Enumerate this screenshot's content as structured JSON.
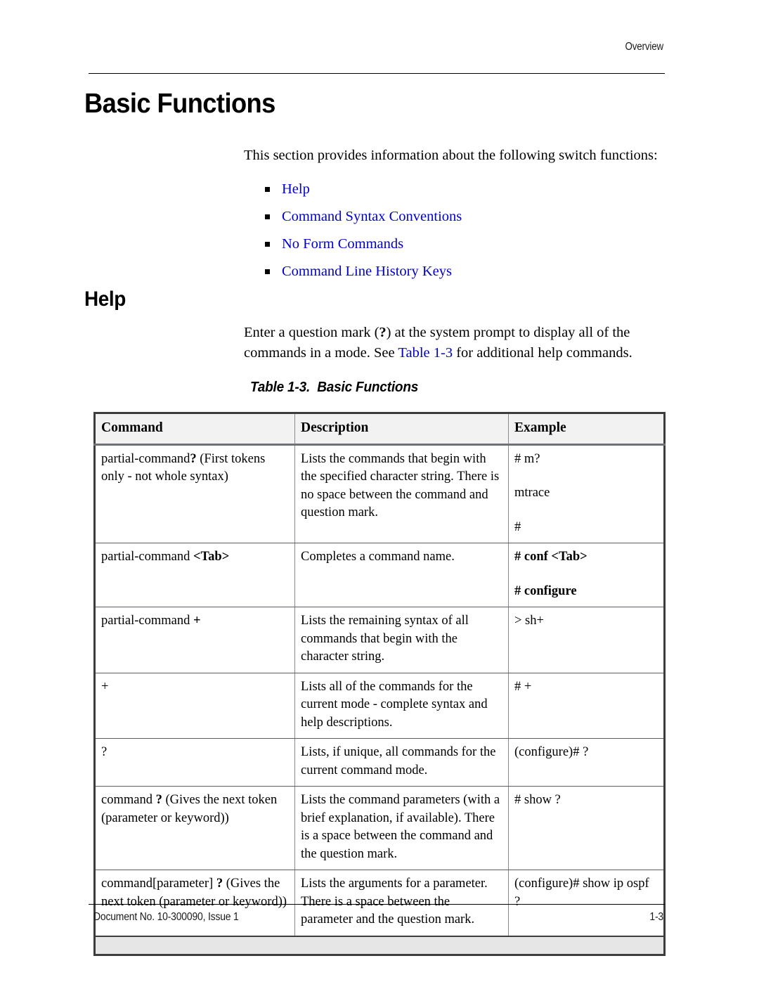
{
  "header": {
    "running_head": "Overview"
  },
  "headings": {
    "h1": "Basic Functions",
    "h2": "Help"
  },
  "intro": {
    "paragraph": "This section provides information about the following switch functions:"
  },
  "bullet_links": [
    {
      "label": "Help"
    },
    {
      "label": "Command Syntax Conventions"
    },
    {
      "label": "No Form Commands"
    },
    {
      "label": "Command Line History Keys"
    }
  ],
  "help_section": {
    "text_before_qmark": "Enter a question mark (",
    "qmark": "?",
    "text_after_qmark": ") at the system prompt to display all of the commands in a mode. See ",
    "table_ref_link": "Table 1-3",
    "text_tail": " for additional help commands."
  },
  "table": {
    "caption_label": "Table 1-3.",
    "caption_title": "Basic Functions",
    "columns": [
      "Command",
      "Description",
      "Example"
    ],
    "rows": [
      {
        "command_plain": "partial-command",
        "command_bold": "?",
        "command_tail": " (First tokens only - not whole syntax)",
        "description": "Lists the commands that begin with the specified character string. There is no space between the command and question mark.",
        "example_lines": [
          "# m?",
          "mtrace",
          "#"
        ],
        "example_bold": false
      },
      {
        "command_plain": "partial-command ",
        "command_bold": "<Tab>",
        "command_tail": "",
        "description": "Completes a command name.",
        "example_lines": [
          "# conf <Tab>",
          "# configure"
        ],
        "example_bold": true
      },
      {
        "command_plain": "partial-command ",
        "command_bold": "+",
        "command_tail": "",
        "description": "Lists the remaining syntax of all commands that begin with the character string.",
        "example_lines": [
          "> sh+"
        ],
        "example_bold": false
      },
      {
        "command_plain": "+",
        "command_bold": "",
        "command_tail": "",
        "description": "Lists all of the commands for the current mode - complete syntax and help descriptions.",
        "example_lines": [
          "# +"
        ],
        "example_bold": false
      },
      {
        "command_plain": "?",
        "command_bold": "",
        "command_tail": "",
        "description": "Lists, if unique, all commands for the current command mode.",
        "example_lines": [
          "(configure)# ?"
        ],
        "example_bold": false
      },
      {
        "command_plain": "command ",
        "command_bold": "?",
        "command_tail": " (Gives the next token (parameter or keyword))",
        "description": "Lists the command parameters (with a brief explanation, if available). There is a space between the command and the question mark.",
        "example_lines": [
          "# show ?"
        ],
        "example_bold": false
      },
      {
        "command_plain": "command[parameter] ",
        "command_bold": "?",
        "command_tail": " (Gives the next token (parameter or keyword))",
        "description": "Lists the arguments for a parameter. There is a space between the parameter and the question mark.",
        "example_lines": [
          "(configure)# show ip ospf ?"
        ],
        "example_bold": false
      }
    ]
  },
  "footer": {
    "document_number": "Document No. 10-300090, Issue 1",
    "page_number": "1-3"
  },
  "colors": {
    "link_blue": "#0000cc",
    "header_row_bg": "#f2f2f2",
    "footer_band_bg": "#e6e6e6",
    "rule_black": "#000000"
  }
}
